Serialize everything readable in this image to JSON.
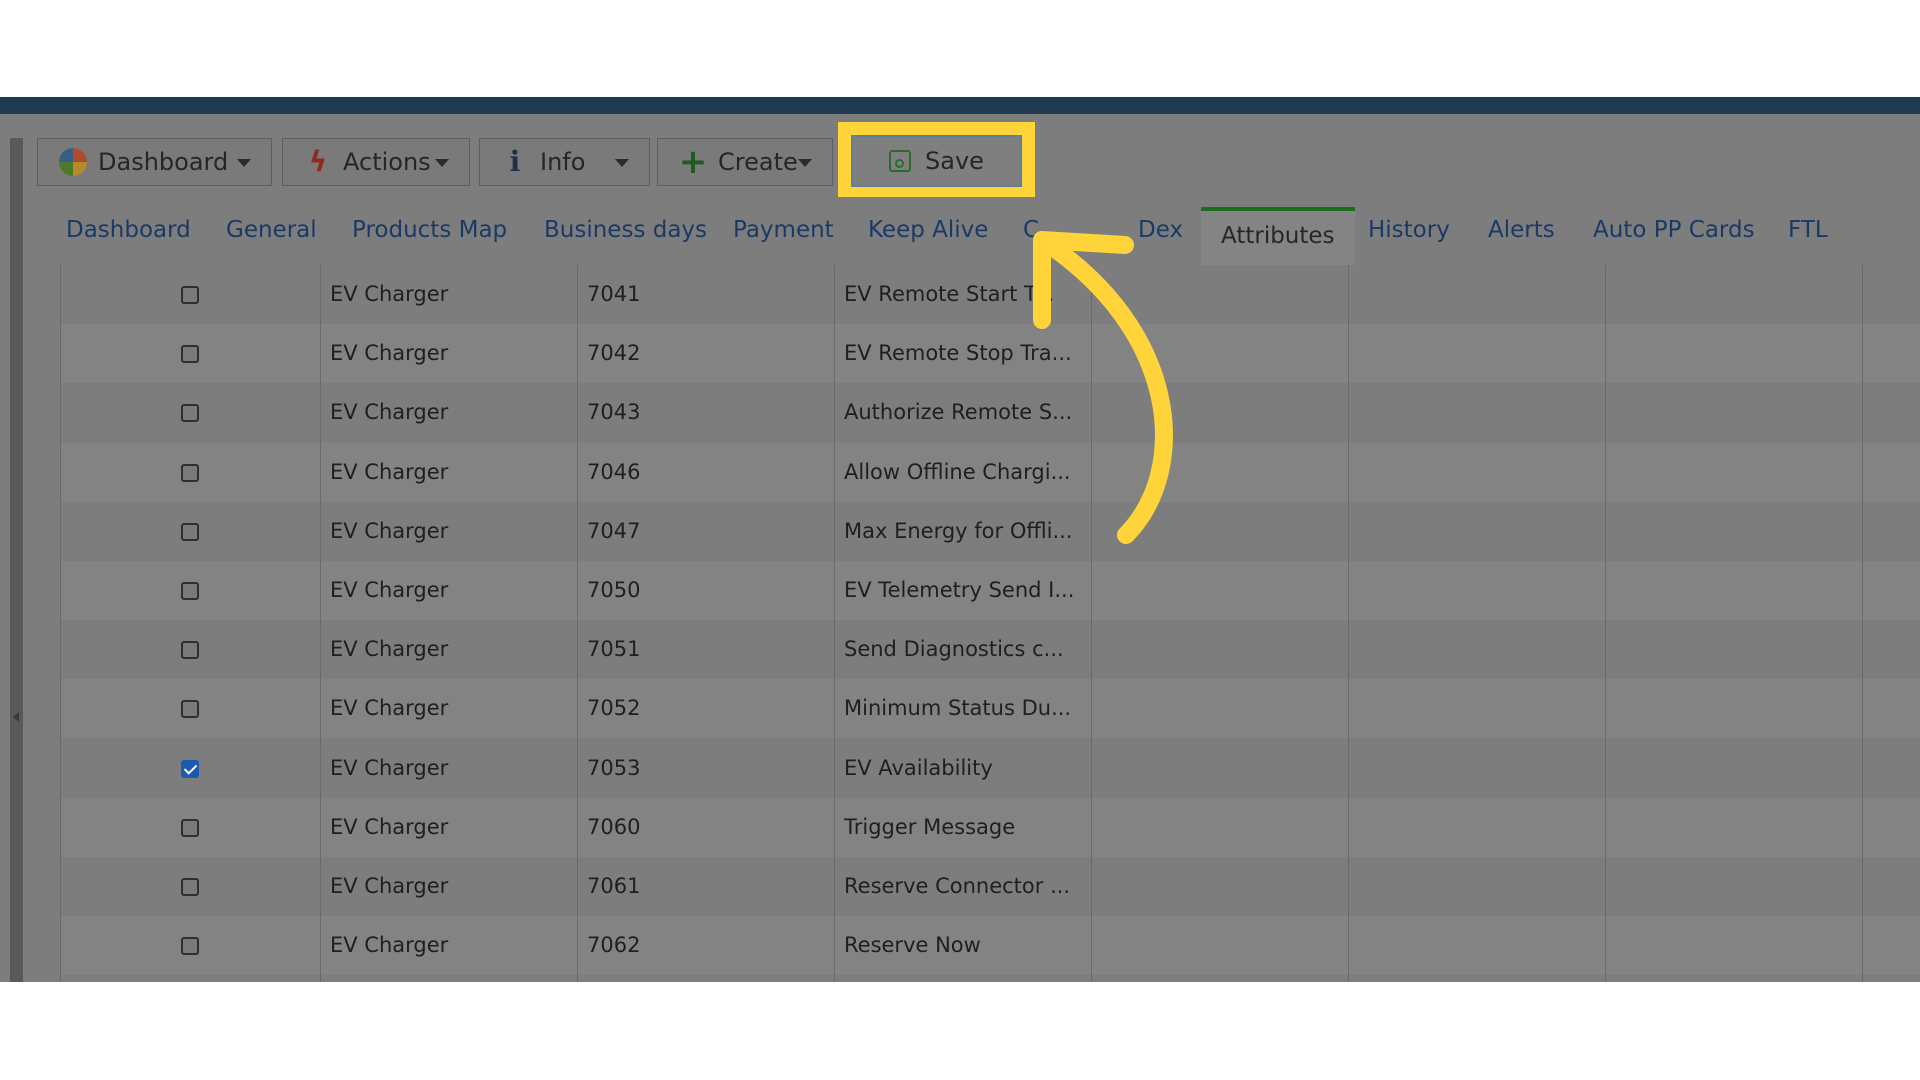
{
  "colors": {
    "accent_highlight": "#ffd43b",
    "active_tab_border": "#1f6b1f",
    "link": "#1a3a66",
    "checkbox_checked": "#1a5ab0"
  },
  "toolbar": {
    "dashboard_label": "Dashboard",
    "actions_label": "Actions",
    "info_label": "Info",
    "create_label": "Create",
    "save_label": "Save"
  },
  "tabs": [
    {
      "label": "Dashboard"
    },
    {
      "label": "General"
    },
    {
      "label": "Products Map"
    },
    {
      "label": "Business days"
    },
    {
      "label": "Payment"
    },
    {
      "label": "Keep Alive"
    },
    {
      "label": "C"
    },
    {
      "label": "Dex"
    },
    {
      "label": "Attributes"
    },
    {
      "label": "History"
    },
    {
      "label": "Alerts"
    },
    {
      "label": "Auto PP Cards"
    },
    {
      "label": "FTL"
    }
  ],
  "active_tab": "Attributes",
  "rows": [
    {
      "checked": false,
      "type": "EV Charger",
      "id": "7041",
      "name": "EV Remote Start T..."
    },
    {
      "checked": false,
      "type": "EV Charger",
      "id": "7042",
      "name": "EV Remote Stop Tra..."
    },
    {
      "checked": false,
      "type": "EV Charger",
      "id": "7043",
      "name": "Authorize Remote S..."
    },
    {
      "checked": false,
      "type": "EV Charger",
      "id": "7046",
      "name": "Allow Offline Chargi..."
    },
    {
      "checked": false,
      "type": "EV Charger",
      "id": "7047",
      "name": "Max Energy for Offli..."
    },
    {
      "checked": false,
      "type": "EV Charger",
      "id": "7050",
      "name": "EV Telemetry Send I..."
    },
    {
      "checked": false,
      "type": "EV Charger",
      "id": "7051",
      "name": "Send Diagnostics c..."
    },
    {
      "checked": false,
      "type": "EV Charger",
      "id": "7052",
      "name": "Minimum Status Du..."
    },
    {
      "checked": true,
      "type": "EV Charger",
      "id": "7053",
      "name": "EV Availability"
    },
    {
      "checked": false,
      "type": "EV Charger",
      "id": "7060",
      "name": "Trigger Message"
    },
    {
      "checked": false,
      "type": "EV Charger",
      "id": "7061",
      "name": "Reserve Connector ..."
    },
    {
      "checked": false,
      "type": "EV Charger",
      "id": "7062",
      "name": "Reserve Now"
    }
  ]
}
